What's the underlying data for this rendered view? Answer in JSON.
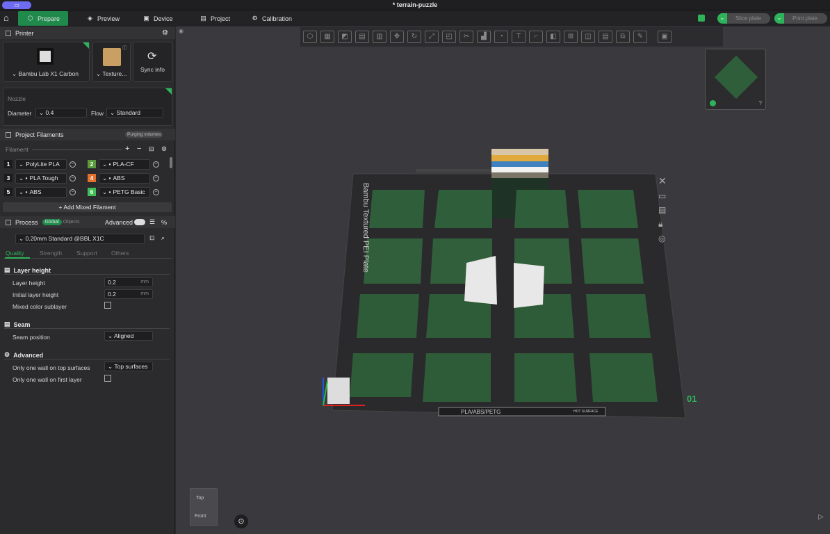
{
  "window": {
    "title": "* terrain-puzzle"
  },
  "tabs": [
    {
      "label": "Prepare"
    },
    {
      "label": "Preview"
    },
    {
      "label": "Device"
    },
    {
      "label": "Project"
    },
    {
      "label": "Calibration"
    }
  ],
  "actions": {
    "slice": "Slice plate",
    "print": "Print plate"
  },
  "printer": {
    "section": "Printer",
    "model": "Bambu Lab X1 Carbon",
    "plate": "Texture...",
    "sync": "Sync info",
    "nozzle": "Nozzle",
    "diameter_label": "Diameter",
    "diameter": "0.4",
    "flow_label": "Flow",
    "flow": "Standard"
  },
  "filaments": {
    "section": "Project Filaments",
    "purge": "Purging volumes",
    "label": "Filament",
    "add_mixed": "Add Mixed Filament",
    "items": [
      {
        "n": "1",
        "name": "PolyLite PLA",
        "color": "#1b1b1b"
      },
      {
        "n": "2",
        "name": "PLA-CF",
        "color": "#5a9a3c"
      },
      {
        "n": "3",
        "name": "PLA Tough",
        "color": "#1b1b1b"
      },
      {
        "n": "4",
        "name": "ABS",
        "color": "#e3702c"
      },
      {
        "n": "5",
        "name": "ABS",
        "color": "#1b1b1b"
      },
      {
        "n": "6",
        "name": "PETG Basic",
        "color": "#3fbf55"
      }
    ]
  },
  "process": {
    "section": "Process",
    "global": "Global",
    "objects": "Objects",
    "advanced": "Advanced",
    "preset": "0.20mm Standard @BBL X1C",
    "tabs": [
      "Quality",
      "Strength",
      "Support",
      "Others"
    ],
    "layer_group": "Layer height",
    "layer_height": "Layer height",
    "layer_height_val": "0.2",
    "initial": "Initial layer height",
    "initial_val": "0.2",
    "unit": "mm",
    "mixed": "Mixed color sublayer",
    "seam_group": "Seam",
    "seam_pos": "Seam position",
    "seam_val": "Aligned",
    "adv_group": "Advanced",
    "one_wall_top": "Only one wall on top surfaces",
    "one_wall_top_val": "Top surfaces",
    "one_wall_first": "Only one wall on first layer"
  },
  "plate": {
    "label": "Bambu Textured PEI Plate",
    "material": "PLA/ABS/PETG",
    "hot": "HOT SURFACE",
    "number": "01"
  },
  "view": {
    "top": "Top",
    "front": "Front"
  }
}
